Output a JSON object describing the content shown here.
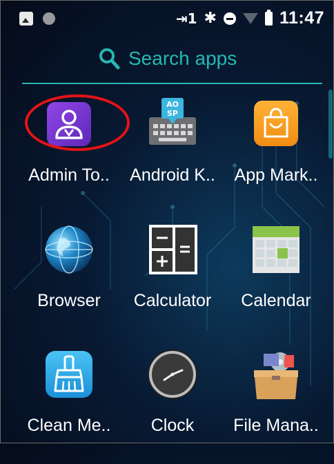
{
  "status_bar": {
    "network": "⇥1",
    "bluetooth": "✱",
    "time": "11:47"
  },
  "search": {
    "placeholder": "Search apps"
  },
  "apps": [
    {
      "label": "Admin To..",
      "icon": "admin-tools-icon"
    },
    {
      "label": "Android K..",
      "icon": "android-keyboard-icon"
    },
    {
      "label": "App Mark..",
      "icon": "app-market-icon"
    },
    {
      "label": "Browser",
      "icon": "browser-icon"
    },
    {
      "label": "Calculator",
      "icon": "calculator-icon"
    },
    {
      "label": "Calendar",
      "icon": "calendar-icon"
    },
    {
      "label": "Clean Me..",
      "icon": "clean-memory-icon"
    },
    {
      "label": "Clock",
      "icon": "clock-icon"
    },
    {
      "label": "File Mana..",
      "icon": "file-manager-icon"
    }
  ],
  "keyboard_icon_text": {
    "line1": "AO",
    "line2": "SP"
  },
  "colors": {
    "accent": "#26b8b2",
    "annotation": "#e31414",
    "admin_purple": "#7b3fd6",
    "market_orange": "#f5a623"
  }
}
